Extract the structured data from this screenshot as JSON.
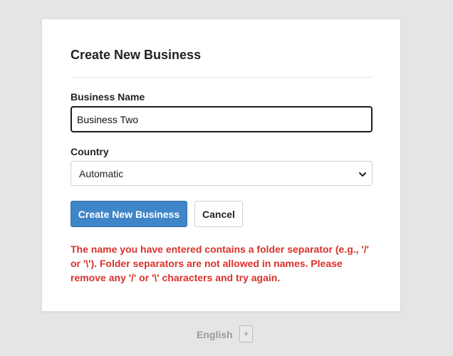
{
  "form": {
    "title": "Create New Business",
    "name_label": "Business Name",
    "name_value": "Business Two",
    "country_label": "Country",
    "country_selected": "Automatic",
    "submit_label": "Create New Business",
    "cancel_label": "Cancel",
    "error_message": "The name you have entered contains a folder separator (e.g., '/' or '\\'). Folder separators are not allowed in names. Please remove any '/' or '\\' characters and try again."
  },
  "footer": {
    "language": "English",
    "add_symbol": "+"
  },
  "colors": {
    "primary": "#3f86c8",
    "error": "#d9312b",
    "background": "#e5e5e5"
  },
  "icons": {
    "select_caret": "chevron-down-icon"
  }
}
